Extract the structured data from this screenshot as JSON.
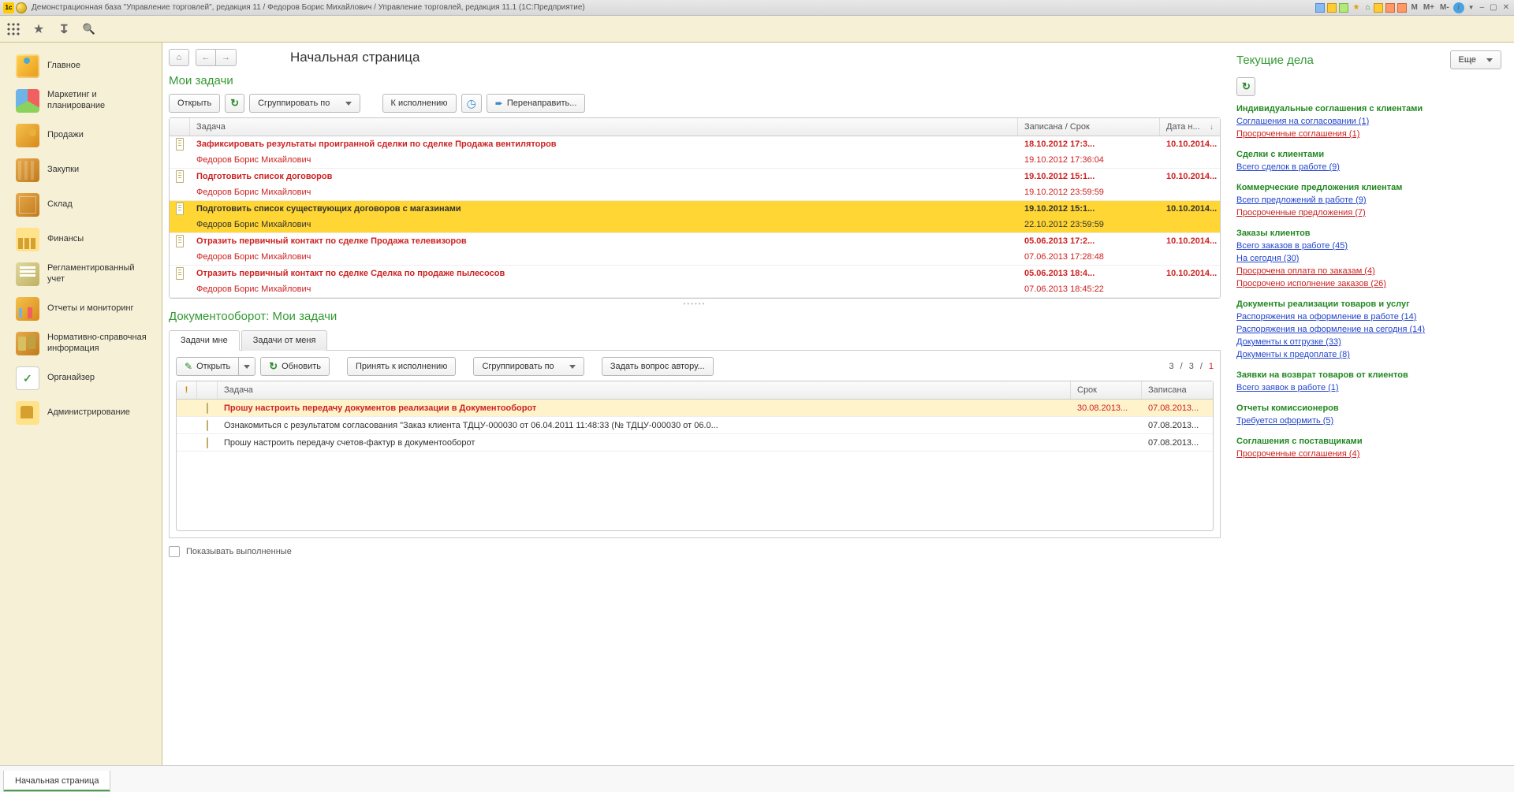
{
  "titlebar": {
    "text": "Демонстрационная база \"Управление торговлей\", редакция 11 / Федоров Борис Михайлович / Управление торговлей, редакция 11.1  (1С:Предприятие)",
    "m": "M",
    "m_plus": "M+",
    "m_minus": "M-"
  },
  "page_title": "Начальная страница",
  "sidebar": {
    "items": [
      {
        "label": "Главное"
      },
      {
        "label": "Маркетинг и планирование"
      },
      {
        "label": "Продажи"
      },
      {
        "label": "Закупки"
      },
      {
        "label": "Склад"
      },
      {
        "label": "Финансы"
      },
      {
        "label": "Регламентированный учет"
      },
      {
        "label": "Отчеты и мониторинг"
      },
      {
        "label": "Нормативно-справочная информация"
      },
      {
        "label": "Органайзер"
      },
      {
        "label": "Администрирование"
      }
    ]
  },
  "tasks": {
    "title": "Мои задачи",
    "open": "Открыть",
    "group_by": "Сгруппировать по",
    "to_exec": "К исполнению",
    "redirect": "Перенаправить...",
    "col_task": "Задача",
    "col_rec": "Записана / Срок",
    "col_date": "Дата н...",
    "rows": [
      {
        "l1": "Зафиксировать результаты проигранной сделки по сделке Продажа вентиляторов",
        "rec1": "18.10.2012 17:3...",
        "date": "10.10.2014...",
        "l2": "Федоров Борис Михайлович",
        "rec2": "19.10.2012 17:36:04",
        "sel": false
      },
      {
        "l1": "Подготовить список договоров",
        "rec1": "19.10.2012 15:1...",
        "date": "10.10.2014...",
        "l2": "Федоров Борис Михайлович",
        "rec2": "19.10.2012 23:59:59",
        "sel": false
      },
      {
        "l1": "Подготовить список существующих договоров с магазинами",
        "rec1": "19.10.2012 15:1...",
        "date": "10.10.2014...",
        "l2": "Федоров Борис Михайлович",
        "rec2": "22.10.2012 23:59:59",
        "sel": true
      },
      {
        "l1": "Отразить первичный контакт по сделке Продажа телевизоров",
        "rec1": "05.06.2013 17:2...",
        "date": "10.10.2014...",
        "l2": "Федоров Борис Михайлович",
        "rec2": "07.06.2013 17:28:48",
        "sel": false
      },
      {
        "l1": "Отразить первичный контакт по сделке Сделка по продаже пылесосов",
        "rec1": "05.06.2013 18:4...",
        "date": "10.10.2014...",
        "l2": "Федоров Борис Михайлович",
        "rec2": "07.06.2013 18:45:22",
        "sel": false
      }
    ]
  },
  "docflow": {
    "title": "Документооборот: Мои задачи",
    "tab1": "Задачи мне",
    "tab2": "Задачи от меня",
    "open": "Открыть",
    "refresh": "Обновить",
    "accept": "Принять к исполнению",
    "group_by": "Сгруппировать по",
    "ask": "Задать вопрос автору...",
    "pager": {
      "cur": "3",
      "sep": "/",
      "tot": "3",
      "sep2": "/",
      "red": "1"
    },
    "col_task": "Задача",
    "col_due": "Срок",
    "col_wr": "Записана",
    "rows": [
      {
        "hl": true,
        "task": "Прошу настроить передачу документов реализации в Документооборот",
        "due": "30.08.2013...",
        "wr": "07.08.2013..."
      },
      {
        "hl": false,
        "task": "Ознакомиться с результатом согласования \"Заказ клиента ТДЦУ-000030 от 06.04.2011 11:48:33 (№ ТДЦУ-000030 от 06.0...",
        "due": "",
        "wr": "07.08.2013..."
      },
      {
        "hl": false,
        "task": "Прошу настроить передачу счетов-фактур в документооборот",
        "due": "",
        "wr": "07.08.2013..."
      }
    ],
    "show_done": "Показывать выполненные"
  },
  "side": {
    "title": "Текущие дела",
    "more": "Еще",
    "groups": [
      {
        "h": "Индивидуальные соглашения с клиентами",
        "links": [
          {
            "c": "blue",
            "t": "Соглашения на согласовании (1)"
          },
          {
            "c": "red",
            "t": "Просроченные соглашения (1)"
          }
        ]
      },
      {
        "h": "Сделки с клиентами",
        "links": [
          {
            "c": "blue",
            "t": "Всего сделок в работе (9)"
          }
        ]
      },
      {
        "h": "Коммерческие предложения клиентам",
        "links": [
          {
            "c": "blue",
            "t": "Всего предложений в работе (9)"
          },
          {
            "c": "red",
            "t": "Просроченные предложения (7)"
          }
        ]
      },
      {
        "h": "Заказы клиентов",
        "links": [
          {
            "c": "blue",
            "t": "Всего заказов в работе (45)"
          },
          {
            "c": "blue",
            "t": "На сегодня (30)"
          },
          {
            "c": "red",
            "t": "Просрочена оплата по заказам (4)"
          },
          {
            "c": "red",
            "t": "Просрочено исполнение заказов (26)"
          }
        ]
      },
      {
        "h": "Документы реализации товаров и услуг",
        "links": [
          {
            "c": "blue",
            "t": "Распоряжения на оформление в работе (14)"
          },
          {
            "c": "blue",
            "t": "Распоряжения на оформление на сегодня (14)"
          },
          {
            "c": "blue",
            "t": "Документы к отгрузке (33)"
          },
          {
            "c": "blue",
            "t": "Документы к предоплате (8)"
          }
        ]
      },
      {
        "h": "Заявки на возврат товаров от клиентов",
        "links": [
          {
            "c": "blue",
            "t": "Всего заявок в работе (1)"
          }
        ]
      },
      {
        "h": "Отчеты комиссионеров",
        "links": [
          {
            "c": "blue",
            "t": "Требуется оформить (5)"
          }
        ]
      },
      {
        "h": "Соглашения с поставщиками",
        "links": [
          {
            "c": "red",
            "t": "Просроченные соглашения (4)"
          }
        ]
      }
    ]
  },
  "bottom_tab": "Начальная страница"
}
